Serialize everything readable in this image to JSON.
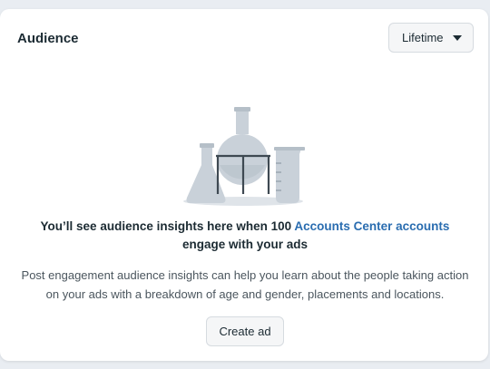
{
  "card": {
    "title": "Audience"
  },
  "date_range": {
    "selected": "Lifetime"
  },
  "empty_state": {
    "illustration": "lab-flasks-illustration",
    "headline_before": "You’ll see audience insights here when 100 ",
    "headline_link": "Accounts Center accounts",
    "headline_after": " engage with your ads",
    "description": "Post engagement audience insights can help you learn about the people taking action on your ads with a breakdown of age and gender, placements and locations."
  },
  "actions": {
    "create_ad_label": "Create ad"
  },
  "colors": {
    "link": "#2a6db0",
    "illustration_fill": "#c9d1d9",
    "illustration_dark": "#3e4952"
  }
}
